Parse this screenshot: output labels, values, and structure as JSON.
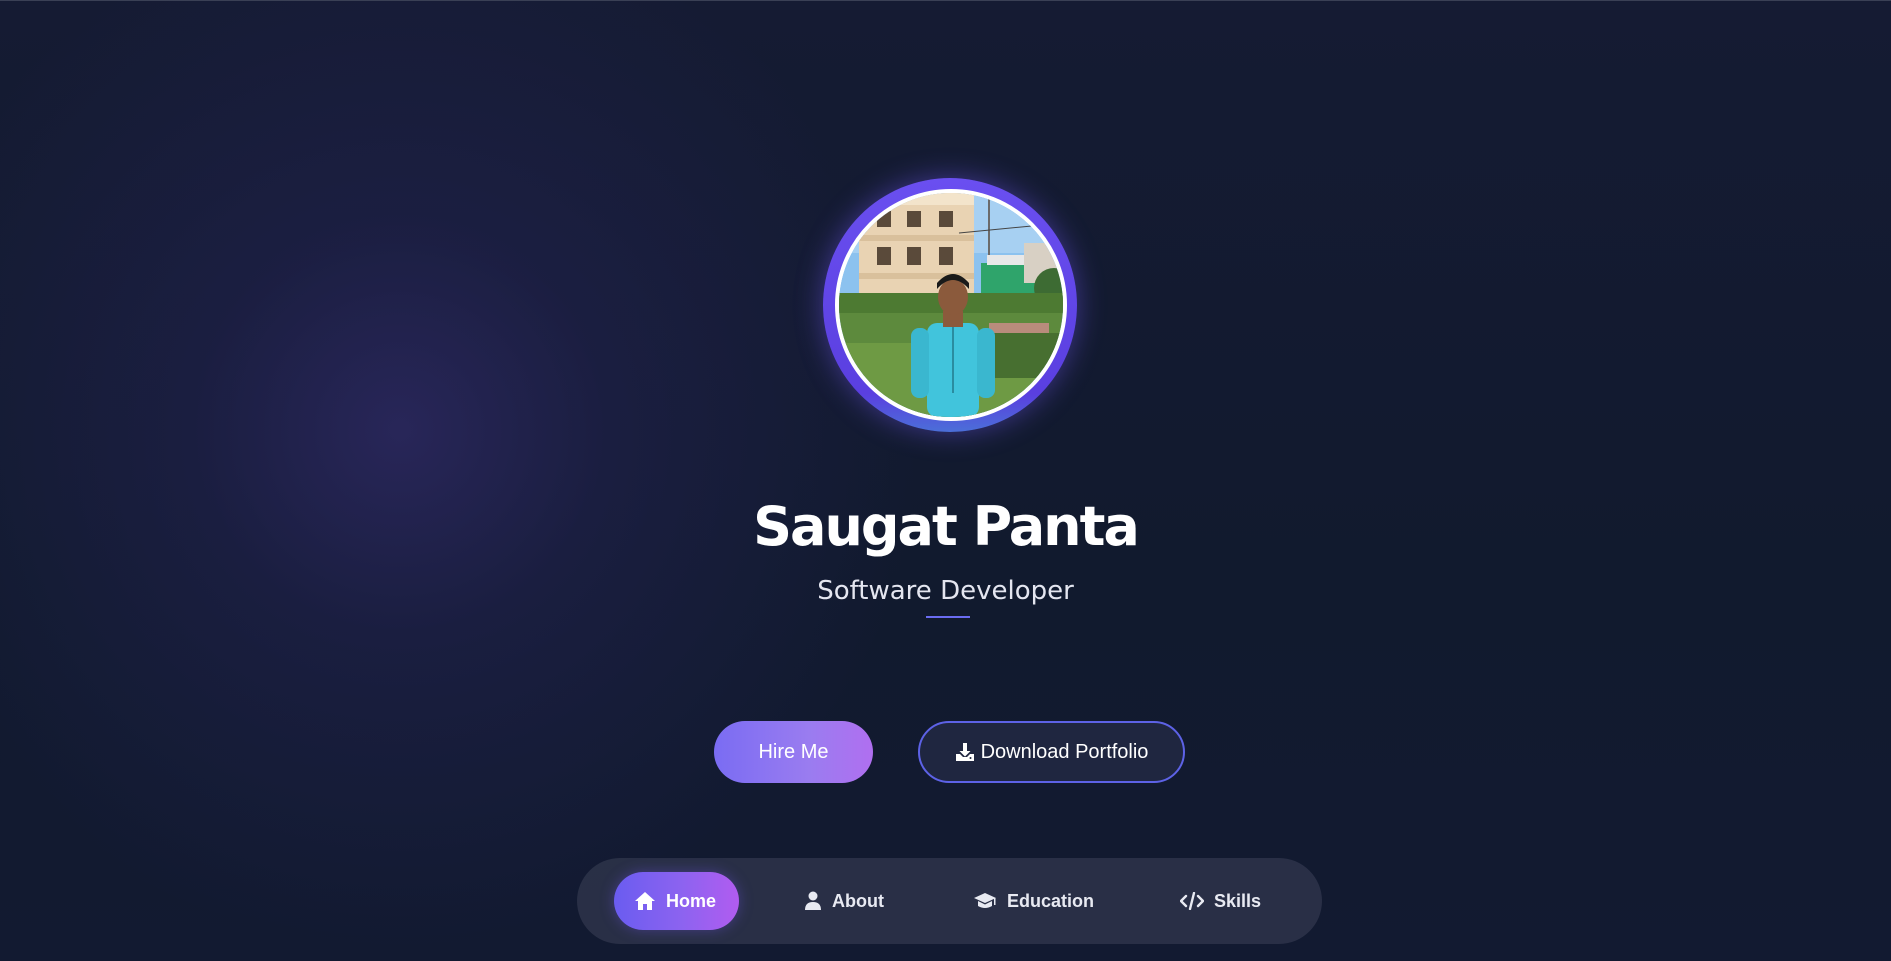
{
  "profile": {
    "name": "Saugat Panta",
    "role": "Software Developer",
    "avatar_icon": "profile-photo"
  },
  "actions": {
    "hire_label": "Hire Me",
    "download_label": "Download Portfolio",
    "download_icon": "download-icon"
  },
  "nav": {
    "items": [
      {
        "label": "Home",
        "icon": "home-icon",
        "active": true
      },
      {
        "label": "About",
        "icon": "user-icon",
        "active": false
      },
      {
        "label": "Education",
        "icon": "graduation-cap-icon",
        "active": false
      },
      {
        "label": "Skills",
        "icon": "code-icon",
        "active": false
      }
    ]
  },
  "colors": {
    "background": "#111a2e",
    "accent": "#6a5cf0",
    "accent_pink": "#b15cf0",
    "outline": "#5d62e6",
    "nav_bg": "#2e344a"
  }
}
